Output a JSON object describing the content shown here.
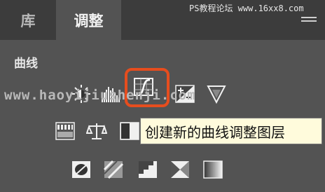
{
  "tabs": [
    {
      "label": "库",
      "active": false
    },
    {
      "label": "调整",
      "active": true
    }
  ],
  "watermark_top": "PS教程论坛 www.16xx8.com",
  "watermark_mid": "www.haoyijiushenji.com",
  "section_title": "曲线",
  "tooltip": "创建新的曲线调整图层",
  "icons": {
    "row1": [
      "brightness-contrast-icon",
      "levels-icon",
      "curves-icon",
      "exposure-icon",
      "vibrance-icon"
    ],
    "row2": [
      "hue-saturation-icon",
      "color-balance-icon",
      "black-white-icon"
    ],
    "row3": [
      "invert-icon",
      "posterize-icon",
      "threshold-icon",
      "selective-color-icon",
      "gradient-map-icon"
    ]
  },
  "colors": {
    "highlight": "#e64d1e",
    "panel": "#535353",
    "tabbar": "#3c3c3c",
    "tooltip_bg": "#fffbdc"
  }
}
